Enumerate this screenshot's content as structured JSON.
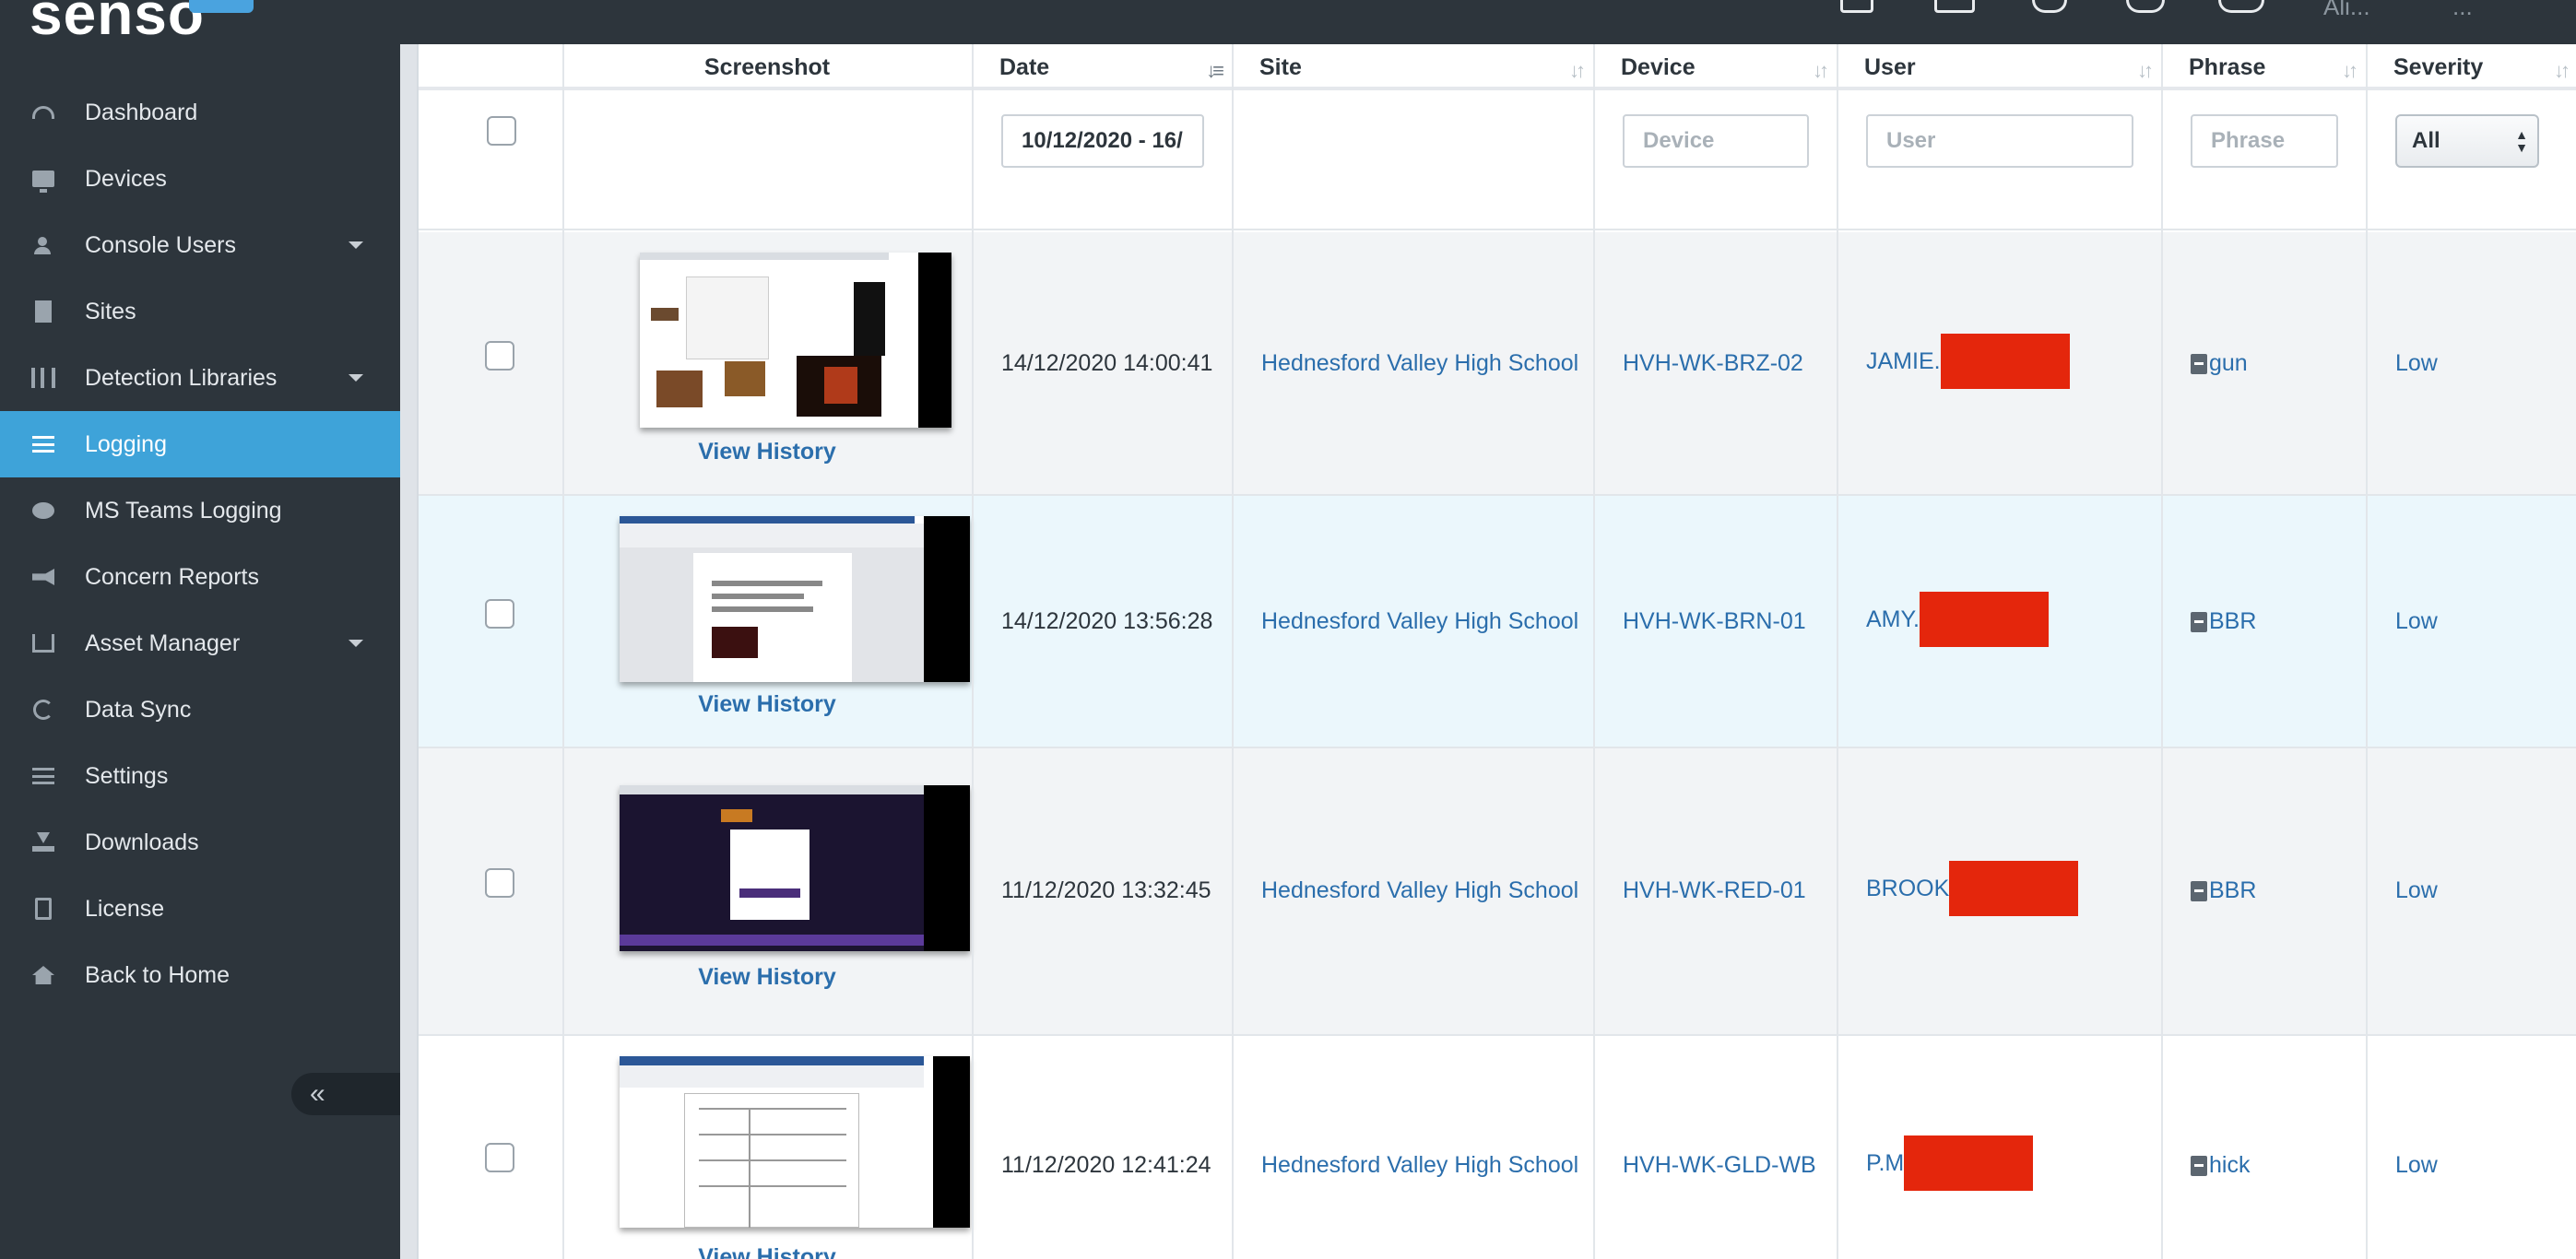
{
  "app": {
    "brand": "senso"
  },
  "topbar": {
    "user_1": "Ali...",
    "user_2": "..."
  },
  "sidebar": {
    "items": [
      {
        "label": "Dashboard",
        "icon": "gauge-icon"
      },
      {
        "label": "Devices",
        "icon": "monitor-icon"
      },
      {
        "label": "Console Users",
        "icon": "users-icon"
      },
      {
        "label": "Sites",
        "icon": "building-icon"
      },
      {
        "label": "Detection Libraries",
        "icon": "books-icon"
      },
      {
        "label": "Logging",
        "icon": "list-icon"
      },
      {
        "label": "MS Teams Logging",
        "icon": "chat-icon"
      },
      {
        "label": "Concern Reports",
        "icon": "megaphone-icon"
      },
      {
        "label": "Asset Manager",
        "icon": "asset-icon"
      },
      {
        "label": "Data Sync",
        "icon": "sync-icon"
      },
      {
        "label": "Settings",
        "icon": "sliders-icon"
      },
      {
        "label": "Downloads",
        "icon": "download-icon"
      },
      {
        "label": "License",
        "icon": "document-icon"
      },
      {
        "label": "Back to Home",
        "icon": "home-icon"
      }
    ],
    "active": "Logging",
    "collapse_label": "«"
  },
  "table": {
    "columns": {
      "screenshot": "Screenshot",
      "date": "Date",
      "site": "Site",
      "device": "Device",
      "user": "User",
      "phrase": "Phrase",
      "severity": "Severity"
    },
    "filters": {
      "date_value": "10/12/2020 - 16/",
      "device_placeholder": "Device",
      "user_placeholder": "User",
      "phrase_placeholder": "Phrase",
      "severity_value": "All"
    },
    "view_history_label": "View History",
    "rows": [
      {
        "date": "14/12/2020 14:00:41",
        "site": "Hednesford Valley High School",
        "device": "HVH-WK-BRZ-02",
        "user": "JAMIE.",
        "phrase": "gun",
        "severity": "Low"
      },
      {
        "date": "14/12/2020 13:56:28",
        "site": "Hednesford Valley High School",
        "device": "HVH-WK-BRN-01",
        "user": "AMY.",
        "phrase": "BBR",
        "severity": "Low"
      },
      {
        "date": "11/12/2020 13:32:45",
        "site": "Hednesford Valley High School",
        "device": "HVH-WK-RED-01",
        "user": "BROOK",
        "phrase": "BBR",
        "severity": "Low"
      },
      {
        "date": "11/12/2020 12:41:24",
        "site": "Hednesford Valley High School",
        "device": "HVH-WK-GLD-WB",
        "user": "P.M",
        "phrase": "hick",
        "severity": "Low"
      }
    ]
  },
  "colors": {
    "sidebar_bg": "#2d353c",
    "active_nav": "#3ea3d9",
    "link": "#2b6eac",
    "redaction": "#e4260c"
  }
}
